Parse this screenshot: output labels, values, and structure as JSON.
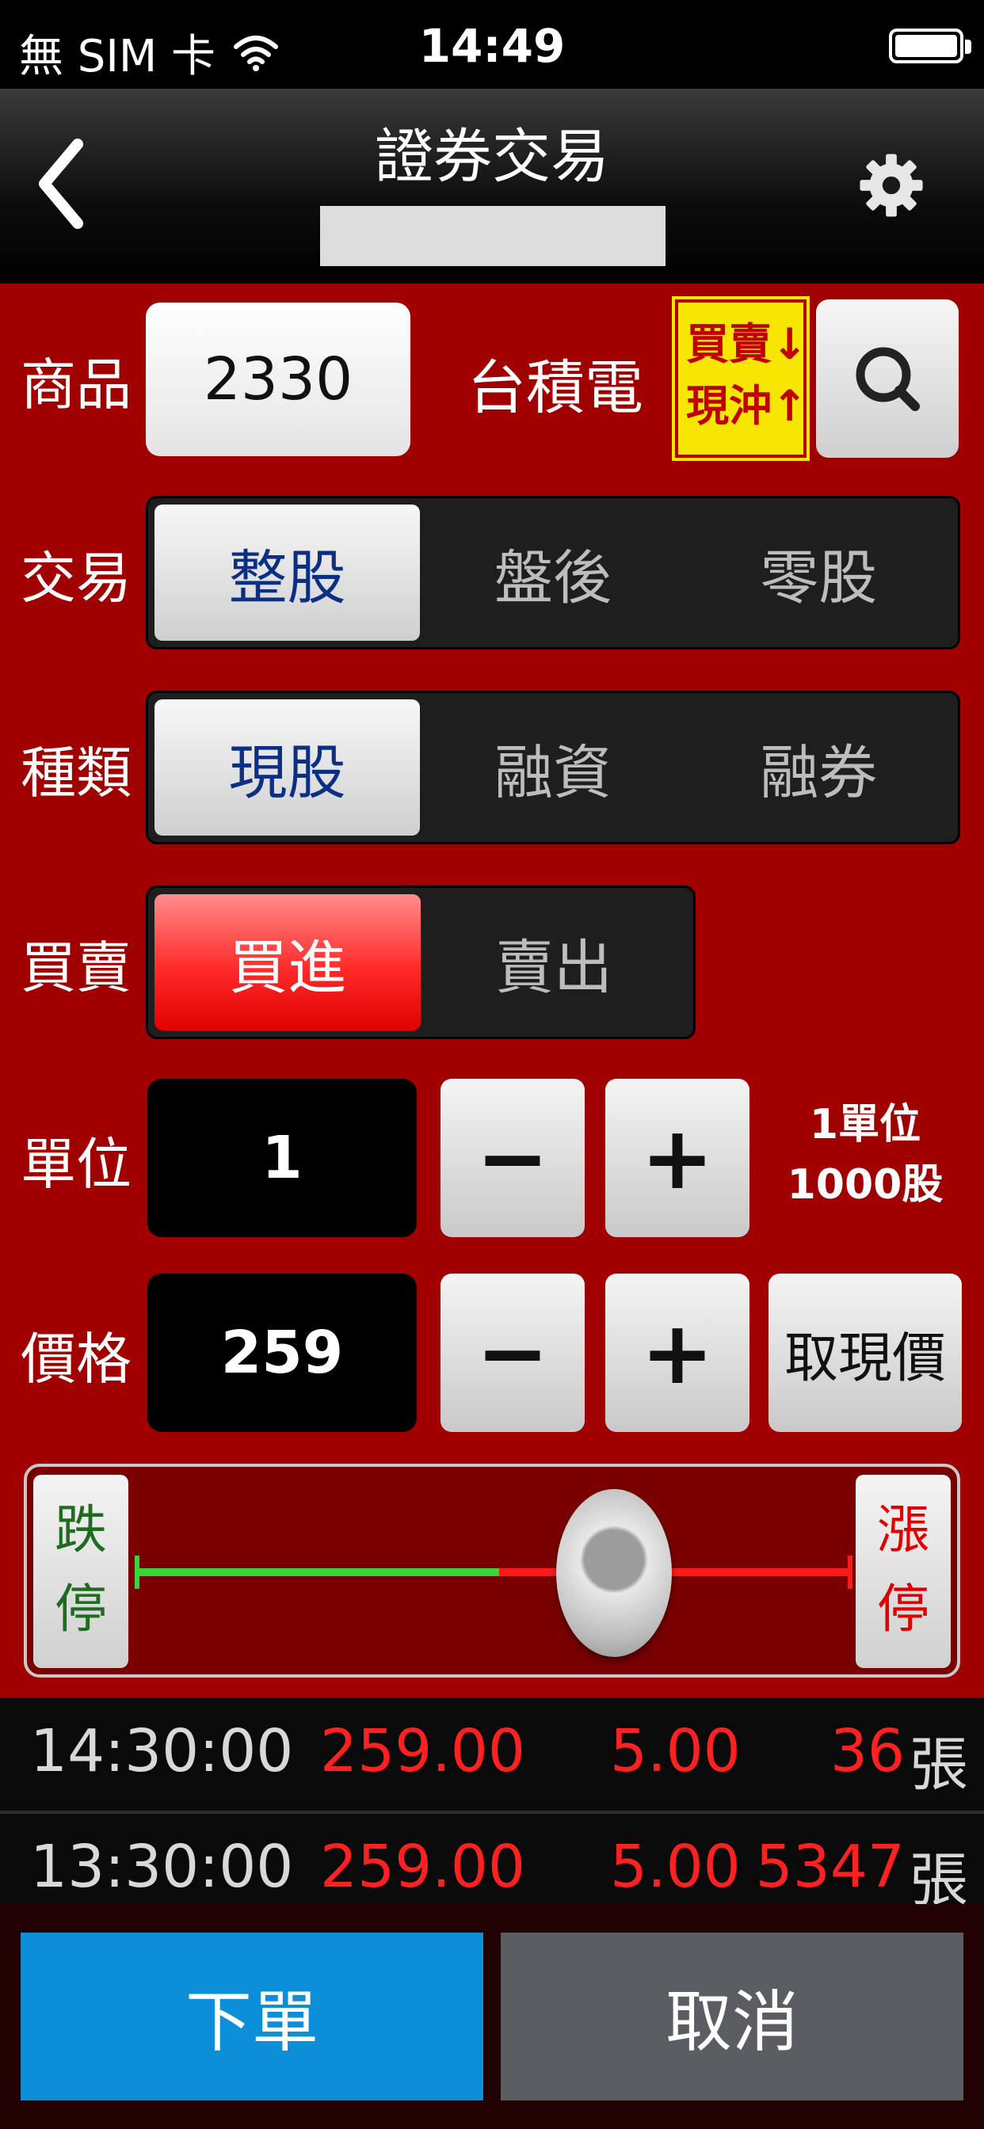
{
  "status_bar": {
    "carrier": "無 SIM 卡",
    "time": "14:49"
  },
  "nav": {
    "title": "證券交易"
  },
  "form": {
    "product": {
      "label": "商品",
      "code": "2330",
      "name": "台積電",
      "daytrade_line1": "買賣↓",
      "daytrade_line2": "現沖↑"
    },
    "trade": {
      "label": "交易",
      "options": [
        "整股",
        "盤後",
        "零股"
      ],
      "selected": "整股"
    },
    "type": {
      "label": "種類",
      "options": [
        "現股",
        "融資",
        "融券"
      ],
      "selected": "現股"
    },
    "side": {
      "label": "買賣",
      "options": [
        "買進",
        "賣出"
      ],
      "selected": "買進"
    },
    "unit": {
      "label": "單位",
      "value": "1",
      "minus": "−",
      "plus": "+",
      "note_line1": "1單位",
      "note_line2": "1000股"
    },
    "price": {
      "label": "價格",
      "value": "259",
      "minus": "−",
      "plus": "+",
      "quote_button": "取現價"
    },
    "slider": {
      "limit_down_1": "跌",
      "limit_down_2": "停",
      "limit_up_1": "漲",
      "limit_up_2": "停",
      "position": 0.5
    }
  },
  "ticks": [
    {
      "time": "14:30:00",
      "price": "259.00",
      "change": "5.00",
      "volume": "36",
      "unit": "張"
    },
    {
      "time": "13:30:00",
      "price": "259.00",
      "change": "5.00",
      "volume": "5347",
      "unit": "張"
    }
  ],
  "actions": {
    "submit": "下單",
    "cancel": "取消"
  },
  "colors": {
    "panel_red": "#a00000",
    "submit_blue": "#0c8fd8",
    "cancel_gray": "#5a5e63",
    "tick_red": "#ff2020",
    "badge_yellow": "#f7e600"
  }
}
